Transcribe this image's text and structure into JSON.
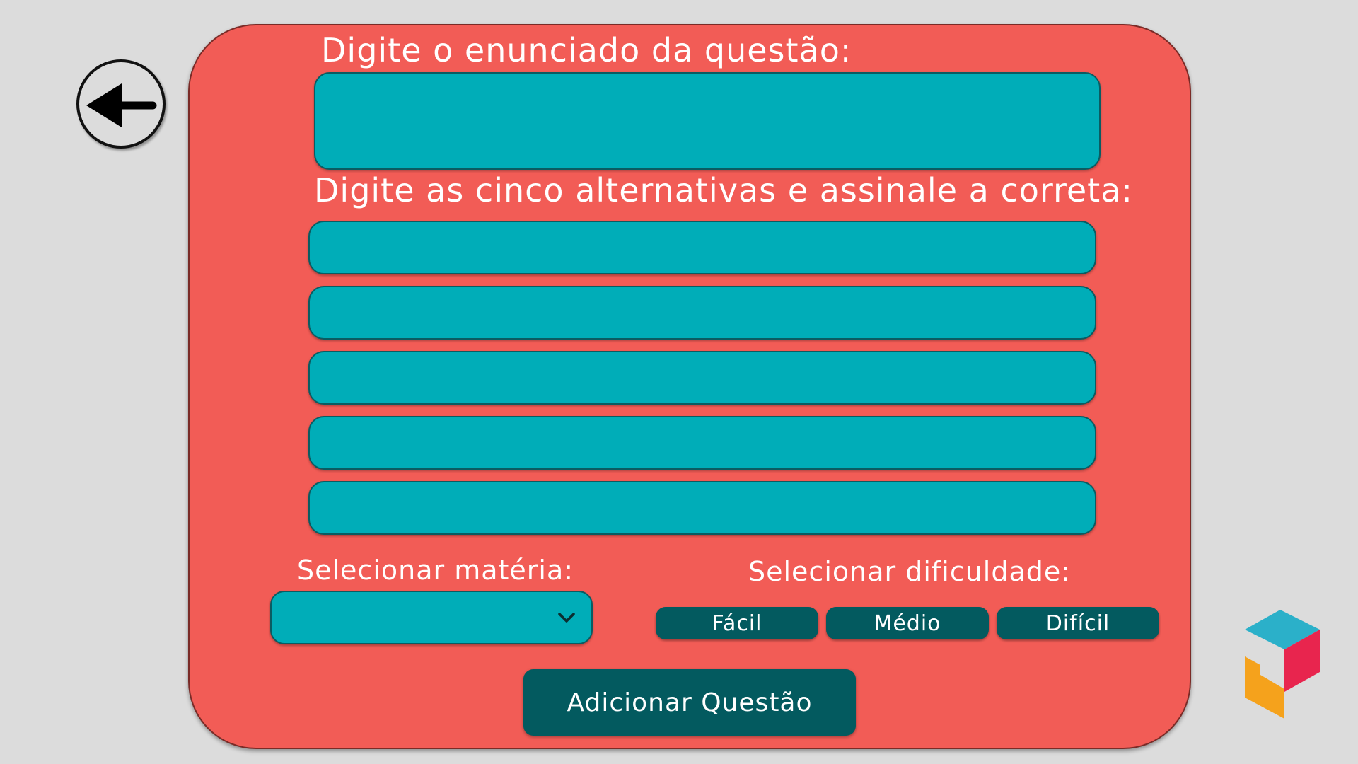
{
  "form": {
    "statement_label": "Digite o enunciado da questão:",
    "statement_value": "",
    "alternatives_label": "Digite as  cinco alternativas e assinale a correta:",
    "alternatives": [
      {
        "value": ""
      },
      {
        "value": ""
      },
      {
        "value": ""
      },
      {
        "value": ""
      },
      {
        "value": ""
      }
    ],
    "subject_label": "Selecionar matéria:",
    "subject_value": "",
    "difficulty_label": "Selecionar dificuldade:",
    "difficulty_options": [
      "Fácil",
      "Médio",
      "Difícil"
    ],
    "submit_label": "Adicionar Questão"
  },
  "icons": {
    "back": "arrow-left-icon",
    "dropdown": "chevron-down-icon",
    "logo": "cube-logo-icon"
  },
  "colors": {
    "background": "#dcdcdc",
    "panel": "#f25c56",
    "field": "#00adb8",
    "button": "#035a5f",
    "text": "#ffffff"
  }
}
